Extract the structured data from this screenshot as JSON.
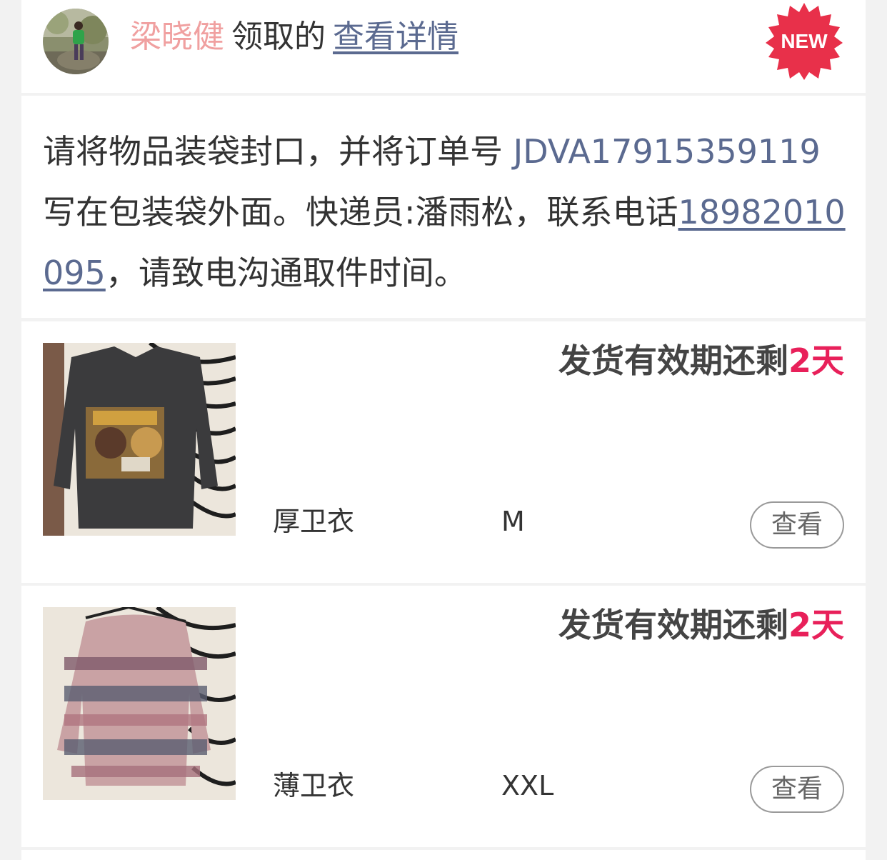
{
  "header": {
    "receiver_name": "梁晓健",
    "claimed_text": "领取的",
    "detail_link": "查看详情",
    "badge": "NEW"
  },
  "notice": {
    "prefix": "请将物品装袋封口，并将订单号 ",
    "order_no": "JDVA17915359119",
    "middle": " 写在包装袋外面。快递员:潘雨松，联系电话",
    "phone": "18982010095",
    "suffix": "，请致电沟通取件时间。"
  },
  "items": [
    {
      "image": "dark-sweatshirt-photo",
      "deadline_text": "发货有效期还剩",
      "deadline_days": "2",
      "deadline_unit": "天",
      "name": "厚卫衣",
      "size": "M",
      "view_label": "查看"
    },
    {
      "image": "tie-dye-sweatshirt-photo",
      "deadline_text": "发货有效期还剩",
      "deadline_days": "2",
      "deadline_unit": "天",
      "name": "薄卫衣",
      "size": "XXL",
      "view_label": "查看"
    }
  ],
  "colors": {
    "accent_red": "#e8205a",
    "link_blue": "#5b6a90",
    "name_pink": "#f0a0a0",
    "badge_red": "#e8304a"
  }
}
